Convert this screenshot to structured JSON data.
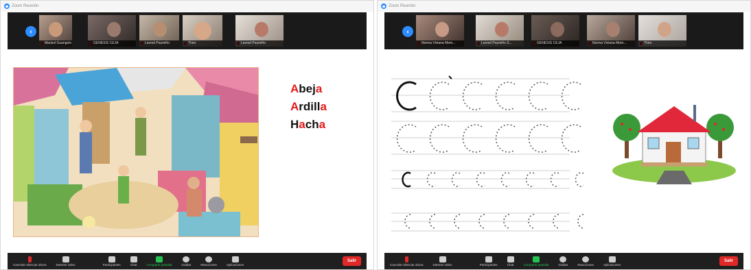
{
  "left_window": {
    "app_title": "Zoom Reunión",
    "participants": [
      {
        "name": "Marisol Guangolo"
      },
      {
        "name": "GENESIS CEJA"
      },
      {
        "name": "Leonel Pazmiño"
      },
      {
        "name": "Thiro"
      },
      {
        "name": "Leonel Pazmiño"
      }
    ],
    "words": [
      {
        "parts": [
          {
            "t": "A",
            "red": true
          },
          {
            "t": "bej",
            "red": false
          },
          {
            "t": "a",
            "red": true
          }
        ]
      },
      {
        "parts": [
          {
            "t": "A",
            "red": true
          },
          {
            "t": "rdill",
            "red": false
          },
          {
            "t": "a",
            "red": true
          }
        ]
      },
      {
        "parts": [
          {
            "t": "H",
            "red": false
          },
          {
            "t": "a",
            "red": true
          },
          {
            "t": "ch",
            "red": false
          },
          {
            "t": "a",
            "red": true
          }
        ]
      }
    ],
    "toolbar": {
      "mute_label": "Cancelar silenciar ahora",
      "video_label": "Detener video",
      "participants_label": "Participantes",
      "participants_count": "8",
      "chat_label": "Chat",
      "share_label": "Compartir pantalla",
      "record_label": "Grabar",
      "reactions_label": "Reacciones",
      "apps_label": "Aplicaciones",
      "leave_label": "Salir"
    }
  },
  "right_window": {
    "app_title": "Zoom Reunión",
    "participants": [
      {
        "name": "Norma Viviana Mem..."
      },
      {
        "name": "Leonel Pazmiño S..."
      },
      {
        "name": "GENESIS CEJA"
      },
      {
        "name": "Norma Viviana Mem..."
      },
      {
        "name": "Thiro"
      }
    ],
    "toolbar": {
      "mute_label": "Cancelar silenciar ahora",
      "video_label": "Detener video",
      "participants_label": "Participantes",
      "participants_count": "8",
      "chat_label": "Chat",
      "share_label": "Compartir pantalla",
      "record_label": "Grabar",
      "reactions_label": "Reacciones",
      "apps_label": "Aplicaciones",
      "leave_label": "Salir"
    }
  },
  "colors": {
    "accent": "#2d8cff",
    "leave": "#e02828",
    "share": "#25c252",
    "word_highlight": "#e41a1a"
  }
}
